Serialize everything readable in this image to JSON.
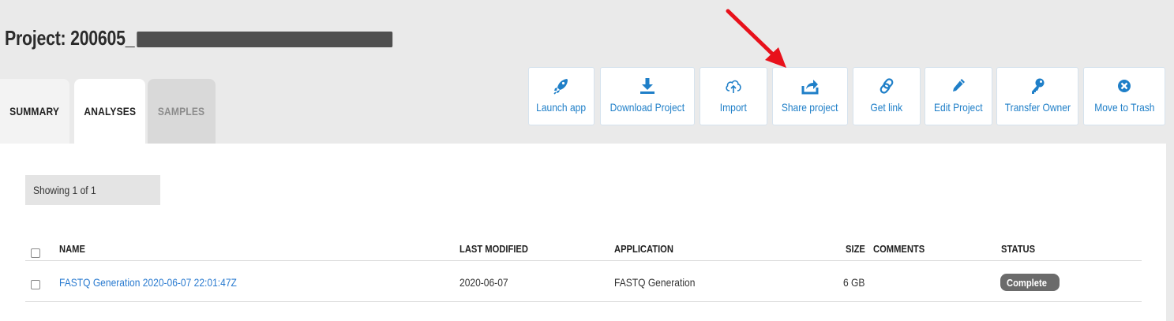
{
  "project": {
    "title": "Project: 200605_"
  },
  "tabs": [
    {
      "label": "SUMMARY"
    },
    {
      "label": "ANALYSES"
    },
    {
      "label": "SAMPLES"
    }
  ],
  "toolbar": [
    {
      "label": "Launch app",
      "icon": "rocket-icon"
    },
    {
      "label": "Download Project",
      "icon": "download-icon"
    },
    {
      "label": "Import",
      "icon": "cloud-upload-icon"
    },
    {
      "label": "Share project",
      "icon": "share-icon"
    },
    {
      "label": "Get link",
      "icon": "link-icon"
    },
    {
      "label": "Edit Project",
      "icon": "pencil-icon"
    },
    {
      "label": "Transfer Owner",
      "icon": "key-icon"
    },
    {
      "label": "Move to Trash",
      "icon": "close-circle-icon"
    }
  ],
  "showing": "Showing 1 of 1",
  "table": {
    "headers": {
      "name": "NAME",
      "last_modified": "LAST MODIFIED",
      "application": "APPLICATION",
      "size": "SIZE",
      "comments": "COMMENTS",
      "status": "STATUS"
    },
    "rows": [
      {
        "name": "FASTQ Generation 2020-06-07 22:01:47Z",
        "last_modified": "2020-06-07",
        "application": "FASTQ Generation",
        "size": "6 GB",
        "comments": "",
        "status": "Complete"
      }
    ]
  },
  "colors": {
    "accent": "#1f7fc8",
    "link": "#2a7bd0",
    "annotation_arrow": "#e8111b",
    "status_badge": "#6b6b6b"
  }
}
